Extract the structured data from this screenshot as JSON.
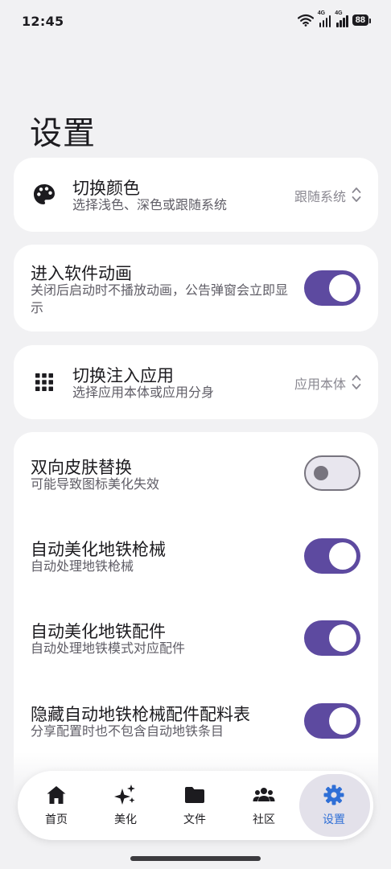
{
  "status": {
    "time": "12:45",
    "battery": "88",
    "net1": "4G",
    "net2": "4G"
  },
  "page": {
    "title": "设置"
  },
  "settings": {
    "theme": {
      "title": "切换颜色",
      "subtitle": "选择浅色、深色或跟随系统",
      "value": "跟随系统",
      "icon": "palette-icon"
    },
    "intro_anim": {
      "title": "进入软件动画",
      "subtitle": "关闭后启动时不播放动画，公告弹窗会立即显示",
      "enabled": true
    },
    "inject_app": {
      "title": "切换注入应用",
      "subtitle": "选择应用本体或应用分身",
      "value": "应用本体",
      "icon": "grid-icon"
    },
    "dual_skin": {
      "title": "双向皮肤替换",
      "subtitle": "可能导致图标美化失效",
      "enabled": false
    },
    "auto_gun": {
      "title": "自动美化地铁枪械",
      "subtitle": "自动处理地铁枪械",
      "enabled": true
    },
    "auto_attach": {
      "title": "自动美化地铁配件",
      "subtitle": "自动处理地铁模式对应配件",
      "enabled": true
    },
    "hide_table": {
      "title": "隐藏自动地铁枪械配件配料表",
      "subtitle": "分享配置时也不包含自动地铁条目",
      "enabled": true
    }
  },
  "nav": {
    "items": [
      {
        "label": "首页",
        "icon": "home-icon"
      },
      {
        "label": "美化",
        "icon": "sparkle-icon"
      },
      {
        "label": "文件",
        "icon": "folder-icon"
      },
      {
        "label": "社区",
        "icon": "community-icon"
      },
      {
        "label": "设置",
        "icon": "gear-icon",
        "active": true
      }
    ]
  },
  "colors": {
    "accent": "#5d4aa0",
    "nav_active": "#2f6fd6",
    "background": "#f1f1f3"
  }
}
